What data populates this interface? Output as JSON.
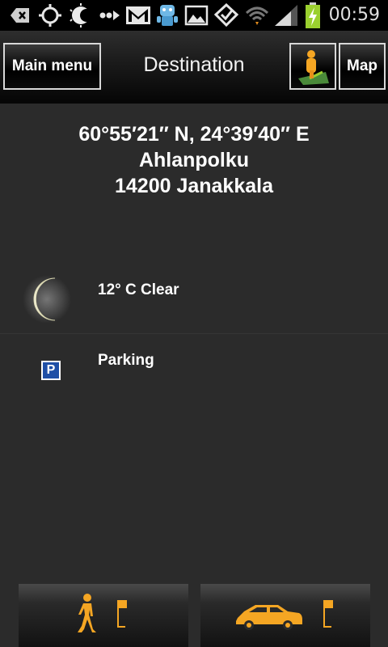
{
  "status_bar": {
    "time": "00:59",
    "icons": [
      "back-icon",
      "gps-icon",
      "moon-icon",
      "forward-dots-icon",
      "gmail-icon",
      "robot-icon",
      "gallery-icon",
      "check-icon",
      "wifi-icon",
      "signal-icon",
      "battery-icon"
    ]
  },
  "action_bar": {
    "main_menu_label": "Main menu",
    "title": "Destination",
    "navigate_icon": "pin-icon",
    "map_label": "Map"
  },
  "destination": {
    "coordinates": "60°55′21″ N, 24°39′40″ E",
    "street": "Ahlanpolku",
    "postal_city": "14200 Janakkala"
  },
  "info": {
    "weather_label": "12° C Clear",
    "parking_label": "Parking",
    "parking_sign": "P"
  },
  "bottom": {
    "walk_icon": "walk-icon",
    "car_icon": "car-icon",
    "flag_icon": "flag-icon"
  },
  "colors": {
    "accent_orange": "#f5a623",
    "parking_blue": "#1f4fa6"
  }
}
